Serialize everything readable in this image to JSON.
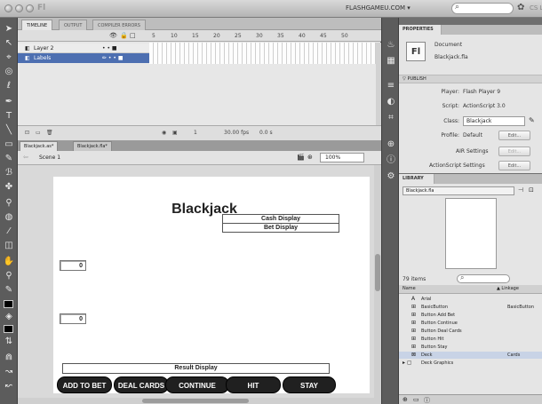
{
  "window": {
    "app_logo": "Fl",
    "workspace": "FLASHGAMEU.COM ▾",
    "cs_live": "CS Live"
  },
  "timeline": {
    "tabs": [
      "TIMELINE",
      "OUTPUT",
      "COMPILER ERRORS"
    ],
    "frame_numbers": [
      "5",
      "10",
      "15",
      "20",
      "25",
      "30",
      "35",
      "40",
      "45",
      "50"
    ],
    "layers": [
      {
        "name": "Layer 2",
        "icons": "•  •  ■"
      },
      {
        "name": "Labels",
        "icons": "✏ •  •  ■"
      }
    ],
    "footer": {
      "frame": "1",
      "fps": "30.00 fps",
      "time": "0.0 s"
    }
  },
  "document": {
    "tabs": [
      "Blackjack.as*",
      "Blackjack.fla*"
    ],
    "scene": "Scene 1",
    "zoom": "100%"
  },
  "stage": {
    "title": "Blackjack",
    "cash_display": "Cash Display",
    "bet_display": "Bet Display",
    "field_top": "0",
    "field_bottom": "0",
    "result_display": "Result Display",
    "buttons": [
      "ADD TO BET",
      "DEAL CARDS",
      "CONTINUE",
      "HIT",
      "STAY"
    ]
  },
  "properties": {
    "tab": "PROPERTIES",
    "doc_icon": "Fl",
    "doc_type": "Document",
    "doc_name": "Blackjack.fla",
    "publish_header": "PUBLISH",
    "player_label": "Player:",
    "player_value": "Flash Player 9",
    "script_label": "Script:",
    "script_value": "ActionScript 3.0",
    "class_label": "Class:",
    "class_value": "Blackjack",
    "profile_label": "Profile:",
    "profile_value": "Default",
    "edit_label": "Edit...",
    "air_settings": "AIR Settings",
    "as_settings": "ActionScript Settings"
  },
  "library": {
    "tab": "LIBRARY",
    "file": "Blackjack.fla",
    "count": "79 items",
    "col_name": "Name",
    "col_linkage": "▲ Linkage",
    "items": [
      {
        "icon": "A",
        "name": "Arial",
        "linkage": ""
      },
      {
        "icon": "⊞",
        "name": "BasicButton",
        "linkage": "BasicButton"
      },
      {
        "icon": "⊞",
        "name": "Button Add Bet",
        "linkage": ""
      },
      {
        "icon": "⊞",
        "name": "Button Continue",
        "linkage": ""
      },
      {
        "icon": "⊞",
        "name": "Button Deal Cards",
        "linkage": ""
      },
      {
        "icon": "⊞",
        "name": "Button Hit",
        "linkage": ""
      },
      {
        "icon": "⊞",
        "name": "Button Stay",
        "linkage": ""
      },
      {
        "icon": "⊠",
        "name": "Deck",
        "linkage": "Cards"
      },
      {
        "icon": "▸ ▢",
        "name": "Deck Graphics",
        "linkage": ""
      }
    ]
  },
  "colors": {
    "selected_layer": "#4d6fb1",
    "stage_button": "#202020"
  }
}
